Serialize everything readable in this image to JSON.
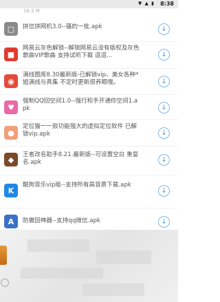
{
  "status_bar": {
    "time": "8:38",
    "icons": "▼ ▲ ▮"
  },
  "partial_top_size": "16.2 M",
  "downloads": [
    {
      "title": "拼信拼网机3.0--骚的一批.apk",
      "icon": "app-icon-grey-square",
      "color": "#8a8a8a"
    },
    {
      "title": "网易云灰色解锁--解锁网易云没有版权及灰色歌曲VIP歌曲 支持试听下载 逗逗...",
      "icon": "app-icon-red-box",
      "color": "#e23b2e"
    },
    {
      "title": "满线图库8.30最新版-已解锁vip、美女各种*姐满线与真集 不定时更新很养眼哦。",
      "icon": "app-icon-red-camera",
      "color": "#e54a3c"
    },
    {
      "title": "强制QQ回空间1.0--强行和手开通你空间1.apk",
      "icon": "app-icon-pink-chat",
      "color": "#e86aa6"
    },
    {
      "title": "定位猫一一款功能强大的虚拟定位软件 已解锁vip.apk",
      "icon": "app-icon-avatar",
      "color": "#f0a07a"
    },
    {
      "title": "王者改名助手8.21.最新版--可设置空白 重复名.apk",
      "icon": "app-icon-game",
      "color": "#7a4a2a"
    },
    {
      "title": "酷狗音乐vip版--支持所有高音质下载.apk",
      "icon": "app-icon-blue-k",
      "color": "#1e88e5"
    },
    {
      "title": "防撤回神器--支持qq微信.apk",
      "icon": "app-icon-a-logo",
      "color": "#3a72c8"
    }
  ],
  "icon_glyphs": {
    "grey-square": "▢",
    "red-box": "■",
    "red-camera": "◉",
    "pink-chat": "♥",
    "avatar": "●",
    "game": "◆",
    "blue-k": "K",
    "a-logo": "A",
    "download": "↓"
  }
}
